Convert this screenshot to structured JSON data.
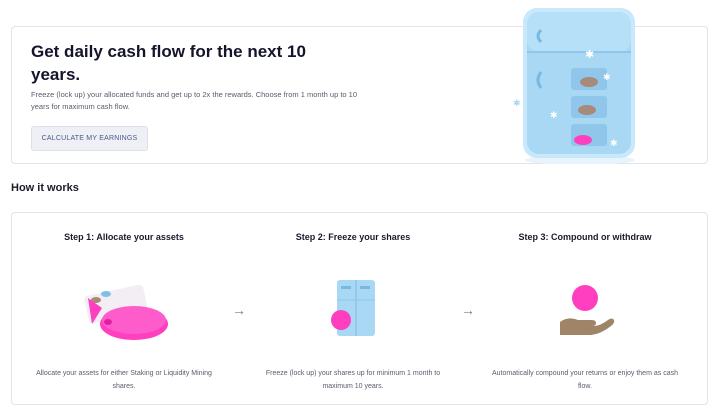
{
  "hero": {
    "title": "Get daily cash flow for the next 10 years.",
    "description": "Freeze (lock up) your allocated funds and get up to 2x the rewards. Choose from 1 month up to 10 years for maximum cash flow.",
    "button_label": "CALCULATE MY EARNINGS"
  },
  "how_it_works": {
    "title": "How it works",
    "steps": [
      {
        "title": "Step 1: Allocate your assets",
        "description": "Allocate your assets for either Staking or Liquidity Mining shares."
      },
      {
        "title": "Step 2: Freeze your shares",
        "description": "Freeze (lock up) your shares up for minimum 1 month to maximum 10 years."
      },
      {
        "title": "Step 3: Compound or withdraw",
        "description": "Automatically compound your returns or enjoy them as cash flow."
      }
    ],
    "arrow_glyph": "→"
  },
  "colors": {
    "accent_pink": "#ff3fbf",
    "fridge_blue": "#a9d8f5",
    "hand_brown": "#a08468"
  },
  "icons": [
    "fridge-illustration",
    "piggy-bank-illustration",
    "mini-fridge-illustration",
    "coin-hand-illustration",
    "arrow-right-icon"
  ]
}
